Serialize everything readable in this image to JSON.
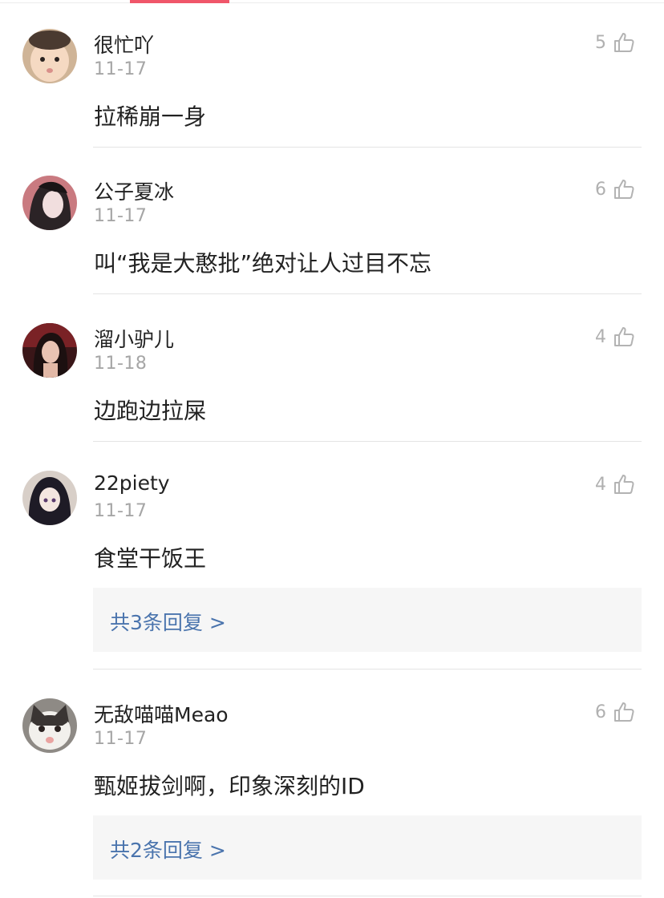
{
  "comments": [
    {
      "username": "很忙吖",
      "date": "11-17",
      "likes": "5",
      "content": "拉稀崩一身",
      "avatar": "baby-face-avatar"
    },
    {
      "username": "公子夏冰",
      "date": "11-17",
      "likes": "6",
      "content": "叫“我是大憨批”绝对让人过目不忘",
      "avatar": "anime-man-avatar"
    },
    {
      "username": "溜小驴儿",
      "date": "11-18",
      "likes": "4",
      "content": "边跑边拉屎",
      "avatar": "woman-portrait-avatar"
    },
    {
      "username": "22piety",
      "date": "11-17",
      "likes": "4",
      "content": "食堂干饭王",
      "reply": "共3条回复 >",
      "avatar": "anime-girl-avatar"
    },
    {
      "username": "无敌喵喵Meao",
      "date": "11-17",
      "likes": "6",
      "content": "甄姬拔剑啊，印象深刻的ID",
      "reply": "共2条回复 >",
      "avatar": "cat-avatar"
    }
  ],
  "colors": {
    "tab_indicator": "#f0566a",
    "reply_link": "#4a74ad",
    "meta_text": "#a6a6a6"
  }
}
